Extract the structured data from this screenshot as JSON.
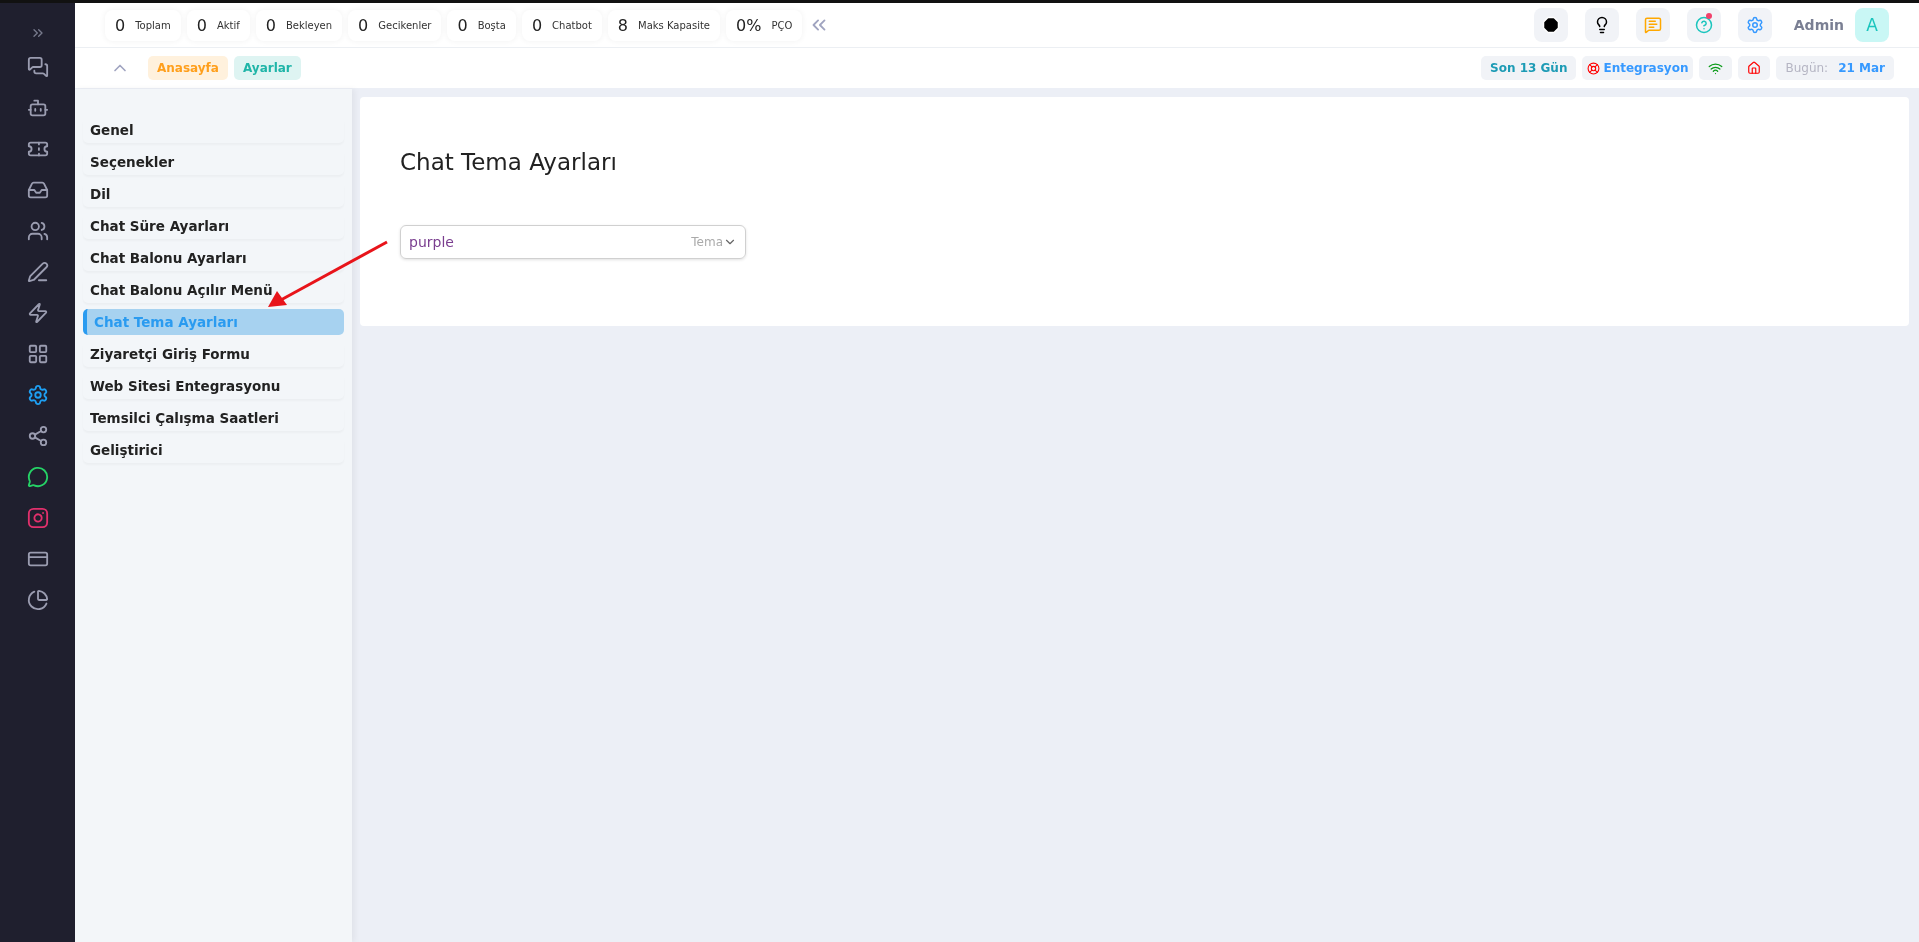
{
  "stats": [
    {
      "value": "0",
      "label": "Toplam"
    },
    {
      "value": "0",
      "label": "Aktif"
    },
    {
      "value": "0",
      "label": "Bekleyen"
    },
    {
      "value": "0",
      "label": "Gecikenler"
    },
    {
      "value": "0",
      "label": "Boşta"
    },
    {
      "value": "0",
      "label": "Chatbot"
    },
    {
      "value": "8",
      "label": "Maks Kapasite"
    },
    {
      "value": "0%",
      "label": "PÇO"
    }
  ],
  "rail": [
    {
      "kind": "chats",
      "selected": false
    },
    {
      "kind": "bot",
      "selected": false
    },
    {
      "kind": "ticket",
      "selected": false
    },
    {
      "kind": "inbox",
      "selected": false
    },
    {
      "kind": "users",
      "selected": false
    },
    {
      "kind": "pen",
      "selected": false
    },
    {
      "kind": "bolt",
      "selected": false
    },
    {
      "kind": "grid",
      "selected": false
    },
    {
      "kind": "settings",
      "selected": true
    },
    {
      "kind": "share",
      "selected": false
    },
    {
      "kind": "whatsapp",
      "selected": false
    },
    {
      "kind": "instagram",
      "selected": false
    },
    {
      "kind": "card",
      "selected": false
    },
    {
      "kind": "pie",
      "selected": false
    }
  ],
  "user": {
    "name": "Admin",
    "initial": "A"
  },
  "breadcrumbs": [
    {
      "label": "Anasayfa",
      "color": "#ff9f1c"
    },
    {
      "label": "Ayarlar",
      "color": "#1fb5a8"
    }
  ],
  "status": {
    "range": "Son 13 Gün",
    "integration": "Entegrasyon",
    "today_label": "Bugün:",
    "today_value": "21 Mar"
  },
  "menu": [
    {
      "label": "Genel",
      "selected": false
    },
    {
      "label": "Seçenekler",
      "selected": false
    },
    {
      "label": "Dil",
      "selected": false
    },
    {
      "label": "Chat Süre Ayarları",
      "selected": false
    },
    {
      "label": "Chat Balonu Ayarları",
      "selected": false
    },
    {
      "label": "Chat Balonu Açılır Menü",
      "selected": false
    },
    {
      "label": "Chat Tema Ayarları",
      "selected": true
    },
    {
      "label": "Ziyaretçi Giriş Formu",
      "selected": false
    },
    {
      "label": "Web Sitesi Entegrasyonu",
      "selected": false
    },
    {
      "label": "Temsilci Çalışma Saatleri",
      "selected": false
    },
    {
      "label": "Geliştirici",
      "selected": false
    }
  ],
  "panel": {
    "title": "Chat Tema Ayarları",
    "select": {
      "value": "purple",
      "label": "Tema"
    }
  }
}
